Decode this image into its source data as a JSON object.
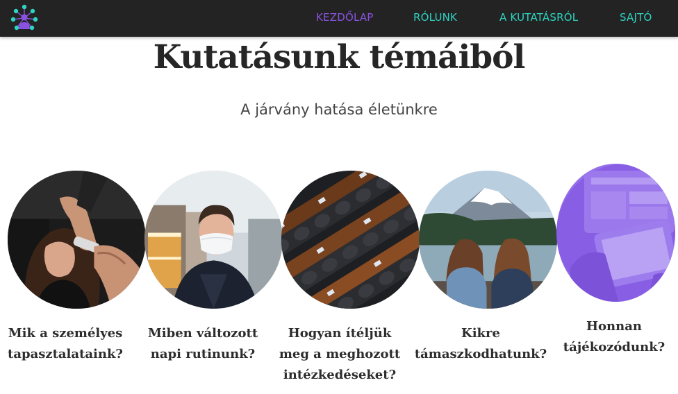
{
  "nav": {
    "items": [
      {
        "label": "KEZDŐLAP",
        "active": true
      },
      {
        "label": "RÓLUNK",
        "active": false
      },
      {
        "label": "A KUTATÁSRÓL",
        "active": false
      },
      {
        "label": "SAJTÓ",
        "active": false
      }
    ]
  },
  "logo": {
    "icon": "people-network-logo",
    "colors": [
      "#2ed3c1",
      "#8a52e0"
    ]
  },
  "page": {
    "title": "Kutatásunk témáiból",
    "subtitle": "A járvány hatása életünkre"
  },
  "topics": [
    {
      "image": "temperature-check-photo",
      "caption_line1": "Mik a személyes",
      "caption_line2": "tapasztalataink?",
      "caption_line3": ""
    },
    {
      "image": "man-with-face-mask-photo",
      "caption_line1": "Miben változott",
      "caption_line2": "napi rutinunk?",
      "caption_line3": ""
    },
    {
      "image": "parliament-seats-photo",
      "caption_line1": "Hogyan ítéljük",
      "caption_line2": "meg a meghozott",
      "caption_line3": "intézkedéseket?"
    },
    {
      "image": "two-girls-by-lake-photo",
      "caption_line1": "Kikre",
      "caption_line2": "támaszkodhatunk?",
      "caption_line3": ""
    },
    {
      "image": "tablet-in-hands-photo",
      "caption_line1": "Honnan",
      "caption_line2": "tájékozódunk?",
      "caption_line3": ""
    }
  ],
  "colors": {
    "nav_bg": "#232323",
    "nav_link": "#2ed3c1",
    "nav_active": "#8a52e0",
    "text": "#262626"
  }
}
